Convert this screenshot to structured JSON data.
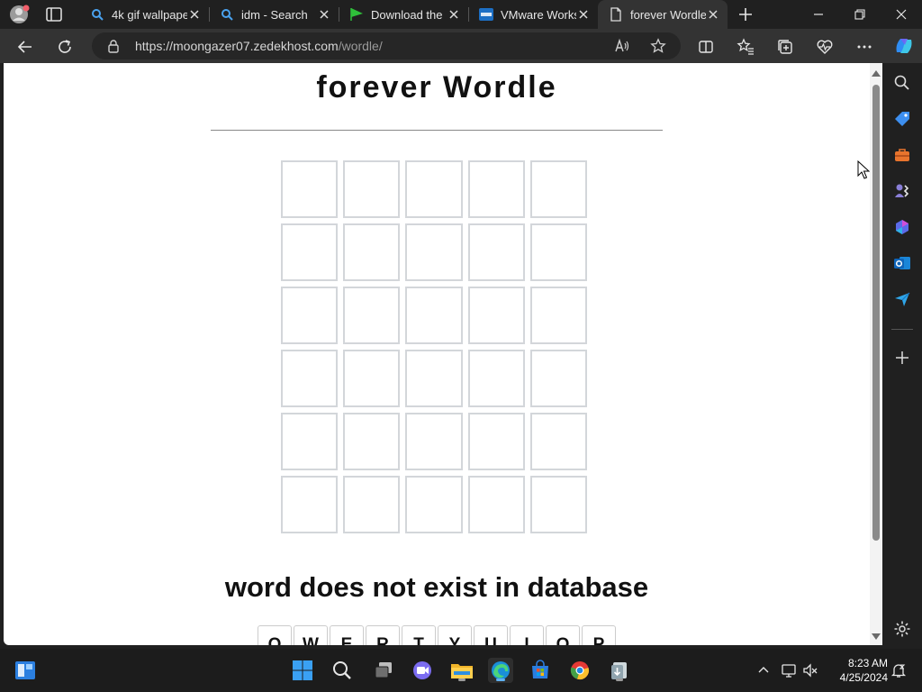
{
  "browser": {
    "tabs": [
      {
        "title": "4k gif wallpape",
        "favicon": "search-icon",
        "active": false
      },
      {
        "title": "idm - Search",
        "favicon": "search-icon",
        "active": false
      },
      {
        "title": "Download the",
        "favicon": "green-flag-icon",
        "active": false
      },
      {
        "title": "VMware Works",
        "favicon": "vmware-icon",
        "active": false
      },
      {
        "title": "forever Wordle",
        "favicon": "page-icon",
        "active": true
      }
    ],
    "url_host": "https://moongazer07.zedekhost.com",
    "url_path": "/wordle/"
  },
  "page": {
    "title": "forever Wordle",
    "message": "word does not exist in database",
    "grid": {
      "rows": 6,
      "cols": 5
    },
    "keyboard_row1": [
      "Q",
      "W",
      "E",
      "R",
      "T",
      "Y",
      "U",
      "I",
      "O",
      "P"
    ]
  },
  "taskbar": {
    "time": "8:23 AM",
    "date": "4/25/2024"
  },
  "colors": {
    "tab_strip": "#202020",
    "toolbar": "#333333",
    "cell_border": "#d3d6da",
    "edge_accent": "#3b9be0"
  }
}
